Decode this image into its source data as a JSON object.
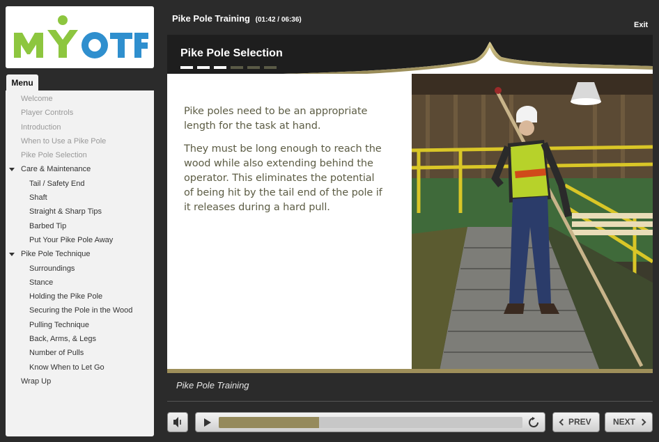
{
  "brand": {
    "logo_text": "MYOTF",
    "logo_green": "#8dc63f",
    "logo_blue": "#2f8fce"
  },
  "menu": {
    "tab_label": "Menu",
    "items": [
      {
        "label": "Welcome",
        "level": 0,
        "visited": true,
        "expandable": false
      },
      {
        "label": "Player Controls",
        "level": 0,
        "visited": true,
        "expandable": false
      },
      {
        "label": "Introduction",
        "level": 0,
        "visited": true,
        "expandable": false
      },
      {
        "label": "When to Use a Pike Pole",
        "level": 0,
        "visited": true,
        "expandable": false
      },
      {
        "label": "Pike Pole Selection",
        "level": 0,
        "visited": true,
        "expandable": false
      },
      {
        "label": "Care & Maintenance",
        "level": 0,
        "visited": false,
        "expandable": true
      },
      {
        "label": "Tail / Safety End",
        "level": 1,
        "visited": false,
        "expandable": false
      },
      {
        "label": "Shaft",
        "level": 1,
        "visited": false,
        "expandable": false
      },
      {
        "label": "Straight & Sharp Tips",
        "level": 1,
        "visited": false,
        "expandable": false
      },
      {
        "label": "Barbed Tip",
        "level": 1,
        "visited": false,
        "expandable": false
      },
      {
        "label": "Put Your Pike Pole Away",
        "level": 1,
        "visited": false,
        "expandable": false
      },
      {
        "label": "Pike Pole Technique",
        "level": 0,
        "visited": false,
        "expandable": true
      },
      {
        "label": "Surroundings",
        "level": 1,
        "visited": false,
        "expandable": false
      },
      {
        "label": "Stance",
        "level": 1,
        "visited": false,
        "expandable": false
      },
      {
        "label": "Holding the Pike Pole",
        "level": 1,
        "visited": false,
        "expandable": false
      },
      {
        "label": "Securing the Pole in the Wood",
        "level": 1,
        "visited": false,
        "expandable": false
      },
      {
        "label": "Pulling Technique",
        "level": 1,
        "visited": false,
        "expandable": false
      },
      {
        "label": "Back, Arms, & Legs",
        "level": 1,
        "visited": false,
        "expandable": false
      },
      {
        "label": "Number of Pulls",
        "level": 1,
        "visited": false,
        "expandable": false
      },
      {
        "label": "Know When to Let Go",
        "level": 1,
        "visited": false,
        "expandable": false
      },
      {
        "label": "Wrap Up",
        "level": 0,
        "visited": false,
        "expandable": false
      }
    ]
  },
  "header": {
    "course_title": "Pike Pole Training",
    "time_display": "(01:42 / 06:36)",
    "exit_label": "Exit"
  },
  "slide": {
    "title": "Pike Pole Selection",
    "progress_total": 6,
    "progress_done": 3,
    "paragraphs": [
      "Pike poles need to be an appropriate length for the task at hand.",
      "They must be long enough to reach the wood while also extending behind the operator. This eliminates the potential of being hit by the tail end of the pole if it releases during a hard pull."
    ],
    "photo_icon": "worker-with-pike-pole-photo",
    "accent_color": "#b3a46a"
  },
  "footer": {
    "title": "Pike Pole Training"
  },
  "player": {
    "progress_fraction": 0.33,
    "volume_icon": "speaker-icon",
    "play_icon": "play-icon",
    "replay_icon": "replay-icon",
    "prev_label": "PREV",
    "next_label": "NEXT"
  }
}
